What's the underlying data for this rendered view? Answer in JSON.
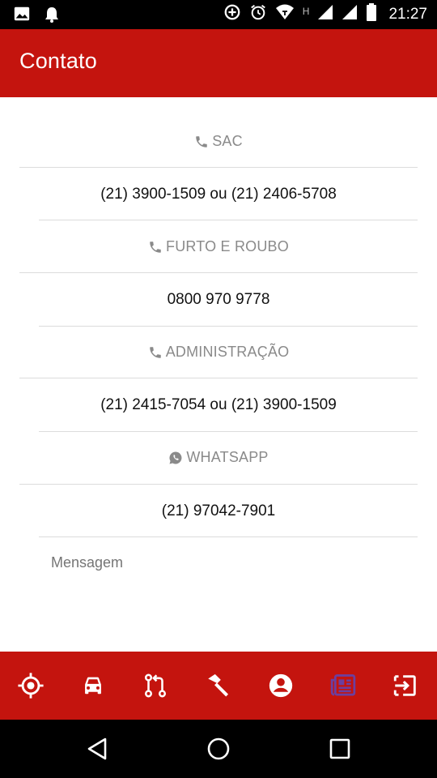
{
  "status_bar": {
    "time": "21:27",
    "icons": [
      "image-icon",
      "notification-bell-icon",
      "data-saver-icon",
      "alarm-icon",
      "wifi-icon",
      "h-network-label",
      "signal-icon",
      "signal-icon-2",
      "battery-icon"
    ],
    "network_label": "H"
  },
  "app_bar": {
    "title": "Contato"
  },
  "contacts": [
    {
      "label": "SAC",
      "icon": "phone-icon",
      "value": "(21) 3900-1509 ou (21) 2406-5708"
    },
    {
      "label": "FURTO E ROUBO",
      "icon": "phone-icon",
      "value": "0800 970 9778"
    },
    {
      "label": "ADMINISTRAÇÃO",
      "icon": "phone-icon",
      "value": "(21) 2415-7054 ou (21) 3900-1509"
    },
    {
      "label": "WHATSAPP",
      "icon": "whatsapp-icon",
      "value": "(21) 97042-7901"
    }
  ],
  "message": {
    "placeholder": "Mensagem"
  },
  "bottom_nav": {
    "items": [
      "location-target-icon",
      "car-icon",
      "route-icon",
      "hammer-icon",
      "account-icon",
      "news-icon",
      "exit-icon"
    ],
    "active": "news-icon",
    "active_color": "#6b3fa0"
  },
  "colors": {
    "primary": "#c4140e",
    "label": "#8a8a8a"
  }
}
